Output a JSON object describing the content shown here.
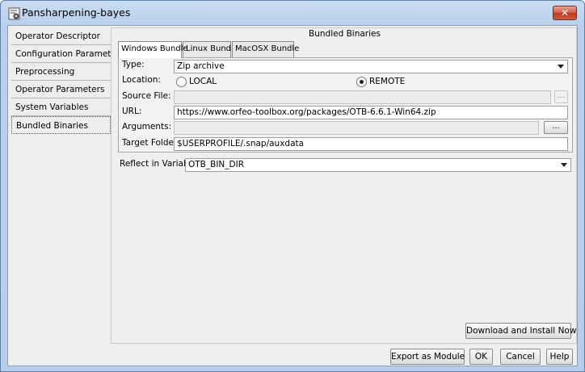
{
  "window": {
    "title": "Pansharpening-bayes"
  },
  "nav": {
    "items": [
      {
        "label": "Operator Descriptor"
      },
      {
        "label": "Configuration Parameters"
      },
      {
        "label": "Preprocessing"
      },
      {
        "label": "Operator Parameters"
      },
      {
        "label": "System Variables"
      },
      {
        "label": "Bundled Binaries"
      }
    ],
    "selected": "Bundled Binaries"
  },
  "bundled": {
    "group_title": "Bundled Binaries",
    "tabs": [
      "Windows Bundle",
      "Linux Bundle",
      "MacOSX Bundle"
    ],
    "active_tab": "Windows Bundle",
    "type_label": "Type:",
    "type_value": "Zip archive",
    "location_label": "Location:",
    "location_local": "LOCAL",
    "location_remote": "REMOTE",
    "location_selected": "REMOTE",
    "source_file_label": "Source File:",
    "source_file_value": "",
    "browse_label": "...",
    "url_label": "URL:",
    "url_value": "https://www.orfeo-toolbox.org/packages/OTB-6.6.1-Win64.zip",
    "arguments_label": "Arguments:",
    "arguments_value": "",
    "arguments_button": "...",
    "target_folder_label": "Target Folder:",
    "target_folder_value": "$USERPROFILE/.snap/auxdata",
    "reflect_label": "Reflect in Variable:",
    "reflect_value": "OTB_BIN_DIR",
    "download_button": "Download and Install Now"
  },
  "footer": {
    "export_button": "Export as Module",
    "ok_button": "OK",
    "cancel_button": "Cancel",
    "help_button": "Help"
  },
  "icons": {
    "app": "gear-document-icon",
    "close": "close-icon",
    "dropdown": "chevron-down-icon"
  },
  "colors": {
    "title_bar": "#b9d0ec",
    "close_button": "#c1371c",
    "panel": "#eeeeee"
  }
}
